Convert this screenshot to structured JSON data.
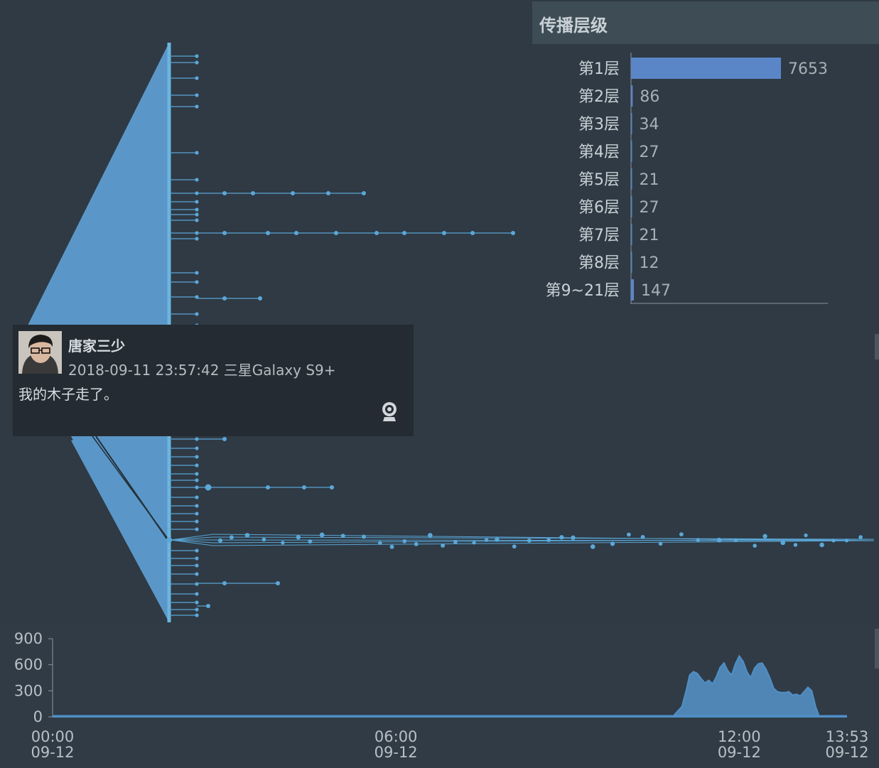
{
  "chart_data": [
    {
      "type": "tree",
      "root_size": 7653,
      "branches": [
        {
          "depth": 9
        },
        {
          "depth": 6
        },
        {
          "depth": 3
        },
        {
          "depth": 4
        },
        {
          "depth": 2
        },
        {
          "depth": 21
        }
      ]
    },
    {
      "type": "bar",
      "title": "传播层级",
      "categories": [
        "第1层",
        "第2层",
        "第3层",
        "第4层",
        "第5层",
        "第6层",
        "第7层",
        "第8层",
        "第9~21层"
      ],
      "values": [
        7653,
        86,
        34,
        27,
        21,
        27,
        21,
        12,
        147
      ],
      "xlim": [
        0,
        7653
      ]
    },
    {
      "type": "area",
      "y_ticks": [
        "900",
        "600",
        "300",
        "0"
      ],
      "ylim": [
        0,
        900
      ],
      "x_ticks": [
        {
          "time": "00:00",
          "date": "09-12",
          "pos": 0
        },
        {
          "time": "06:00",
          "date": "09-12",
          "pos": 360
        },
        {
          "time": "12:00",
          "date": "09-12",
          "pos": 720
        },
        {
          "time": "13:53",
          "date": "09-12",
          "pos": 833
        }
      ],
      "x": [
        0,
        100,
        200,
        300,
        400,
        500,
        600,
        650,
        660,
        665,
        668,
        672,
        676,
        680,
        684,
        688,
        692,
        696,
        700,
        704,
        708,
        712,
        716,
        720,
        724,
        728,
        732,
        736,
        740,
        744,
        748,
        752,
        756,
        760,
        764,
        768,
        772,
        776,
        780,
        784,
        788,
        792,
        796,
        800,
        804,
        808,
        812,
        816,
        820,
        824,
        828,
        832,
        833
      ],
      "y": [
        0,
        0,
        0,
        0,
        0,
        0,
        0,
        0,
        120,
        330,
        480,
        520,
        500,
        440,
        390,
        420,
        380,
        460,
        570,
        620,
        530,
        480,
        610,
        700,
        640,
        520,
        450,
        560,
        610,
        620,
        550,
        450,
        330,
        290,
        280,
        280,
        290,
        250,
        260,
        240,
        290,
        340,
        300,
        120,
        0,
        0,
        0,
        0,
        0,
        0,
        0,
        0,
        0
      ]
    }
  ],
  "tooltip": {
    "name": "唐家三少",
    "meta": "2018-09-11 23:57:42 三星Galaxy S9+",
    "text": "我的木子走了。",
    "icon": "camera-icon"
  },
  "colors": {
    "accent": "#5ba8d8",
    "bar": "#5a86c8",
    "area": "#4f86b5",
    "text": "#c9d1d6",
    "background": "#2f3a44"
  }
}
